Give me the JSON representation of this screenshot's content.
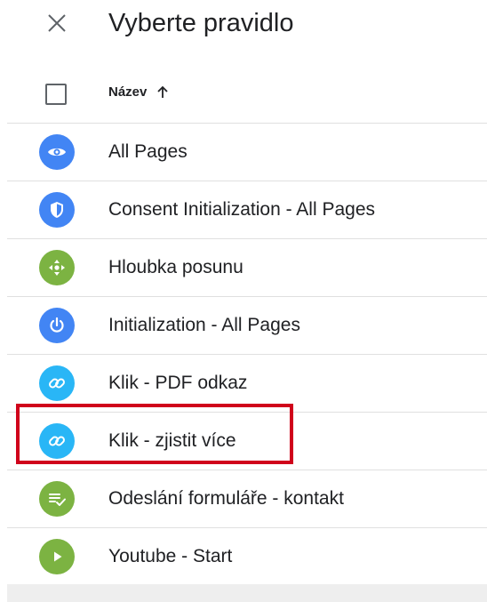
{
  "dialog": {
    "title": "Vyberte pravidlo"
  },
  "table": {
    "column_name": "Název"
  },
  "triggers": [
    {
      "label": "All Pages",
      "icon": "eye-icon",
      "color": "#4285f4"
    },
    {
      "label": "Consent Initialization - All Pages",
      "icon": "shield-icon",
      "color": "#4285f4"
    },
    {
      "label": "Hloubka posunu",
      "icon": "move-arrows-icon",
      "color": "#7cb342"
    },
    {
      "label": "Initialization - All Pages",
      "icon": "power-icon",
      "color": "#4285f4"
    },
    {
      "label": "Klik - PDF odkaz",
      "icon": "link-icon",
      "color": "#29b6f6"
    },
    {
      "label": "Klik - zjistit více",
      "icon": "link-icon",
      "color": "#29b6f6"
    },
    {
      "label": "Odeslání formuláře - kontakt",
      "icon": "form-check-icon",
      "color": "#7cb342"
    },
    {
      "label": "Youtube - Start",
      "icon": "play-icon",
      "color": "#7cb342"
    }
  ],
  "highlight_color": "#d0021b"
}
